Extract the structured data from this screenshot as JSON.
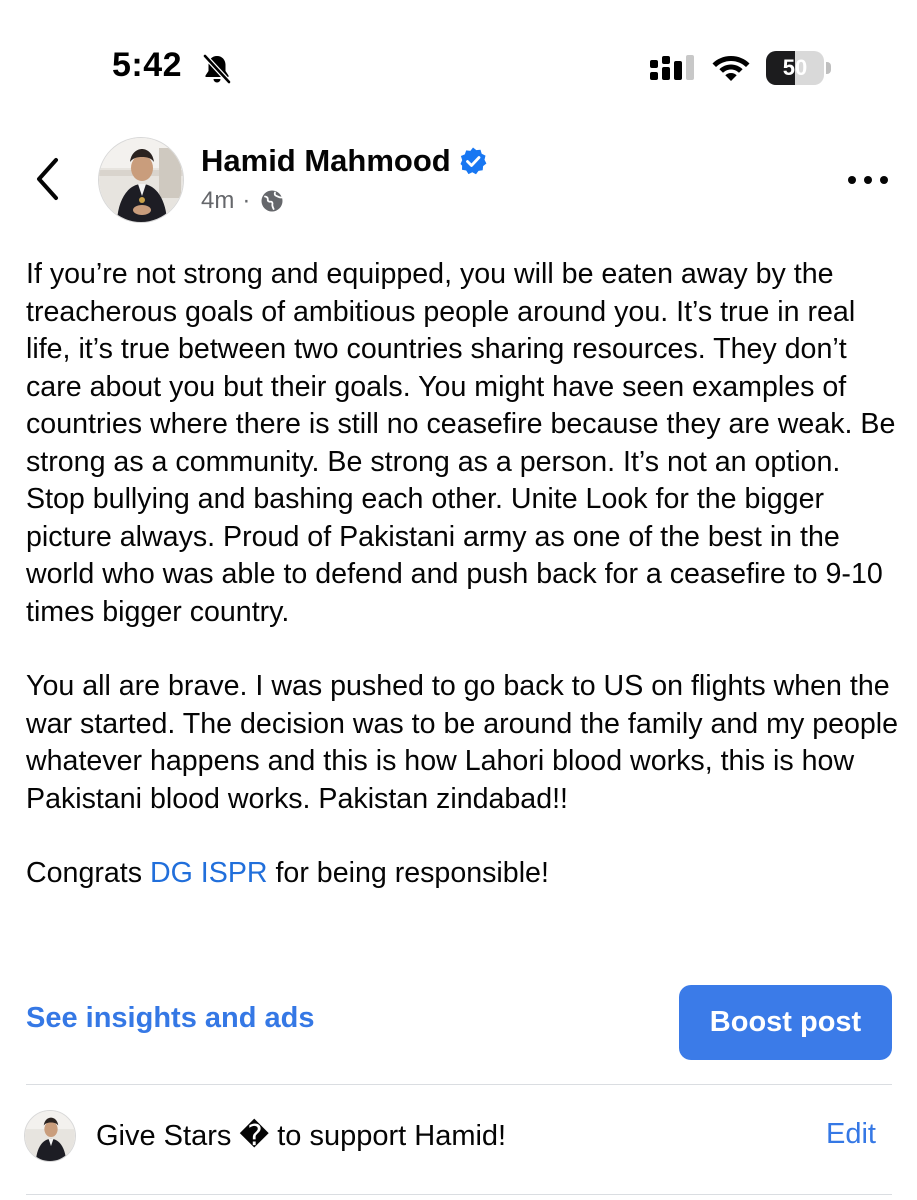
{
  "status_bar": {
    "time": "5:42",
    "battery_level": "50",
    "battery_fraction": 0.5,
    "icons": [
      "bell-off-icon",
      "signal-icon",
      "wifi-icon",
      "battery-icon"
    ]
  },
  "header": {
    "back_icon": "chevron-left-icon",
    "author_name": "Hamid Mahmood",
    "verified_icon": "verified-badge-icon",
    "timestamp": "4m",
    "separator": "·",
    "audience_icon": "globe-icon",
    "more_icon": "more-horizontal-icon"
  },
  "post": {
    "paragraphs": [
      "If you’re not strong and equipped, you will be eaten away by the treacherous goals of ambitious people around you. It’s true in real life, it’s true between two countries sharing resources. They don’t care about you but their goals. You might have seen examples of countries where there is still no ceasefire because they are weak.  Be strong as a community. Be strong as a person. It’s not an option. Stop bullying and bashing each other. Unite  Look for the bigger picture always. Proud of Pakistani army as one of the best in the world who was able to defend and push back for a ceasefire to 9-10 times bigger country.",
      "You all are brave. I was pushed to go back to US on flights when the war started. The decision was to be around the family and my people whatever happens and this is how Lahori blood works, this is how Pakistani blood works. Pakistan zindabad!!"
    ],
    "congrats_prefix": "Congrats ",
    "mention": "DG ISPR",
    "congrats_suffix": " for being responsible!"
  },
  "actions": {
    "insights_label": "See insights and ads",
    "boost_label": "Boost post"
  },
  "stars": {
    "text": "Give Stars � to support Hamid!",
    "edit_label": "Edit"
  },
  "colors": {
    "link": "#3578e5",
    "mention": "#216fdb",
    "boost_bg": "#3b7be8",
    "verified": "#1877f2",
    "meta_gray": "#65676b"
  }
}
